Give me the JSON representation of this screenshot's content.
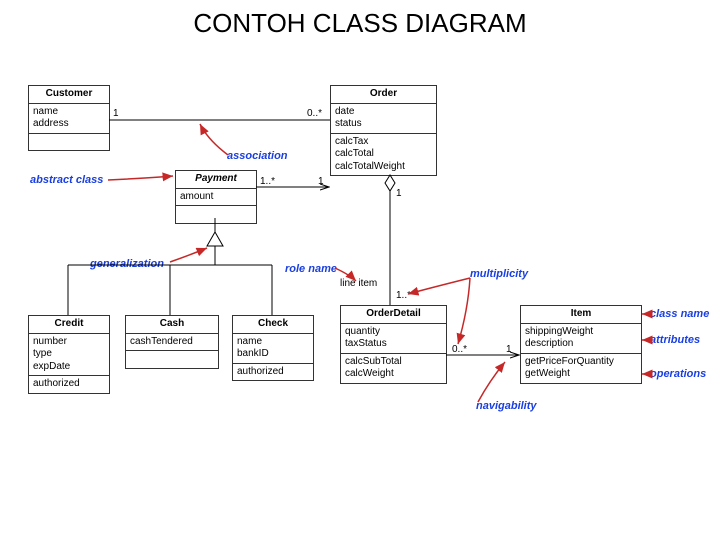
{
  "title": "CONTOH CLASS DIAGRAM",
  "classes": {
    "customer": {
      "name": "Customer",
      "attrs": [
        "name",
        "address"
      ],
      "ops": []
    },
    "order": {
      "name": "Order",
      "attrs": [
        "date",
        "status"
      ],
      "ops": [
        "calcTax",
        "calcTotal",
        "calcTotalWeight"
      ]
    },
    "payment": {
      "name": "Payment",
      "attrs": [
        "amount"
      ],
      "ops": []
    },
    "credit": {
      "name": "Credit",
      "attrs": [
        "number",
        "type",
        "expDate"
      ],
      "ops": [
        "authorized"
      ]
    },
    "cash": {
      "name": "Cash",
      "attrs": [
        "cashTendered"
      ],
      "ops": []
    },
    "check": {
      "name": "Check",
      "attrs": [
        "name",
        "bankID"
      ],
      "ops": [
        "authorized"
      ]
    },
    "orderDetail": {
      "name": "OrderDetail",
      "attrs": [
        "quantity",
        "taxStatus"
      ],
      "ops": [
        "calcSubTotal",
        "calcWeight"
      ]
    },
    "item": {
      "name": "Item",
      "attrs": [
        "shippingWeight",
        "description"
      ],
      "ops": [
        "getPriceForQuantity",
        "getWeight"
      ]
    }
  },
  "mult": {
    "cust1": "1",
    "ordMany": "0..*",
    "payMany": "1..*",
    "ord1": "1",
    "ordAgg1": "1",
    "lineMany": "1..*",
    "odMany": "0..*",
    "item1": "1",
    "roleName": "line item"
  },
  "ann": {
    "abstract": "abstract class",
    "association": "association",
    "generalization": "generalization",
    "roleName": "role name",
    "multiplicity": "multiplicity",
    "className": "class name",
    "attributes": "attributes",
    "operations": "operations",
    "navigability": "navigability"
  }
}
